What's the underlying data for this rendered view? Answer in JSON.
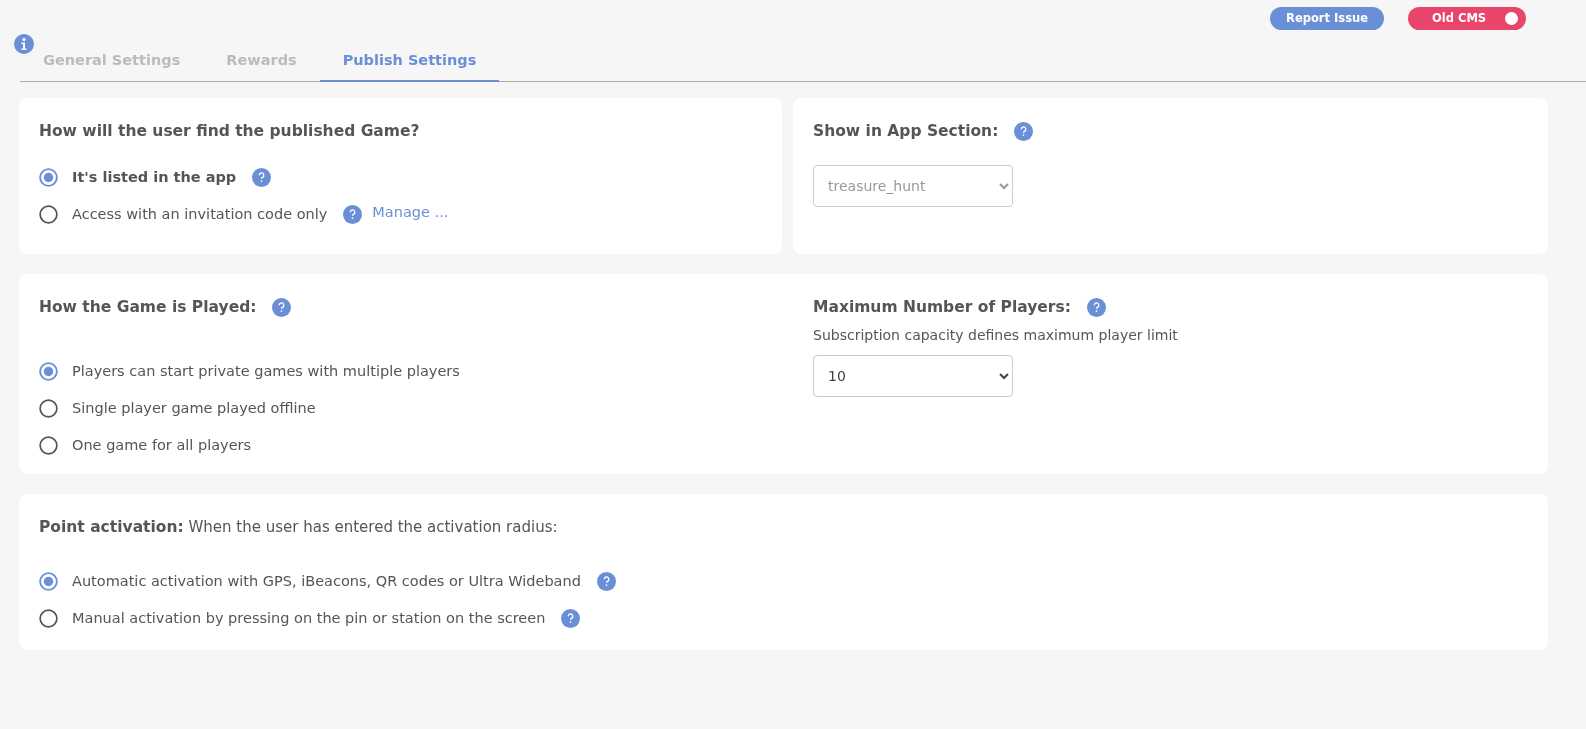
{
  "header": {
    "report_button": "Report Issue",
    "cms_toggle": {
      "label": "Old CMS",
      "on": true
    }
  },
  "tabs": [
    {
      "label": "General Settings",
      "selected": false
    },
    {
      "label": "Rewards",
      "selected": false
    },
    {
      "label": "Publish Settings",
      "selected": true
    }
  ],
  "discovery": {
    "title": "How will the user find the published Game?",
    "help": false,
    "options": [
      {
        "label": "It's listed in the app",
        "selected": true,
        "bold": true,
        "help": true
      },
      {
        "label": "Access with an invitation code only",
        "selected": false,
        "bold": false,
        "help": true,
        "link": "Manage ..."
      }
    ]
  },
  "app_section": {
    "title": "Show in App Section:",
    "help": true,
    "select": {
      "value": "treasure_hunt",
      "disabled": true
    }
  },
  "play_mode": {
    "title": "How the Game is Played:",
    "help": true,
    "options": [
      {
        "label": "Players can start private games with multiple players",
        "selected": true,
        "bold": false,
        "help": false
      },
      {
        "label": "Single player game played offline",
        "selected": false,
        "bold": false,
        "help": false
      },
      {
        "label": "One game for all players",
        "selected": false,
        "bold": false,
        "help": false
      }
    ]
  },
  "max_players": {
    "title": "Maximum Number of Players:",
    "help": true,
    "note": "Subscription capacity defines maximum player limit",
    "select": {
      "value": "10",
      "disabled": false
    }
  },
  "point_activation": {
    "title": "**Point activation:** When the user has entered the activation radius:",
    "help": false,
    "options": [
      {
        "label": "Automatic activation with GPS, iBeacons, QR codes or Ultra Wideband",
        "selected": true,
        "bold": false,
        "help": true
      },
      {
        "label": "Manual activation by pressing on the pin or station on the screen",
        "selected": false,
        "bold": false,
        "help": true
      }
    ]
  }
}
